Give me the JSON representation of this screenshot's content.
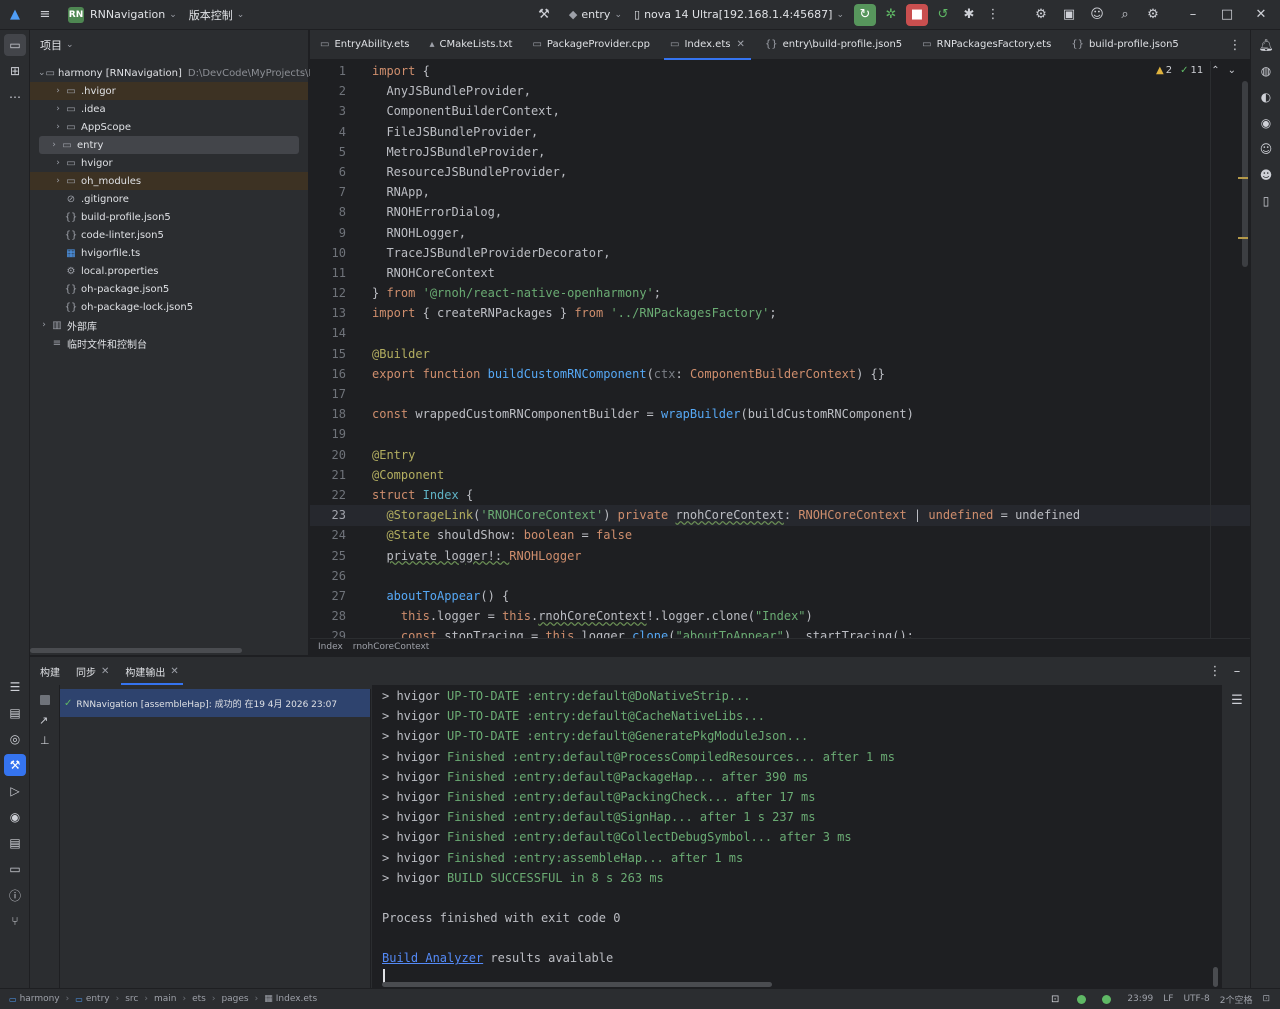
{
  "titlebar": {
    "project_badge": "RN",
    "project_name": "RNNavigation",
    "vcs": "版本控制",
    "module": "entry",
    "device": "nova 14 Ultra[192.168.1.4:45687]"
  },
  "project_panel": {
    "title": "项目",
    "tree": [
      {
        "label": "harmony [RNNavigation]",
        "hint": "D:\\DevCode\\MyProjects\\RNNa",
        "indent": 0,
        "chev": "v",
        "icon": "module-icon",
        "style": ""
      },
      {
        "label": ".hvigor",
        "indent": 1,
        "chev": ">",
        "icon": "folder-icon",
        "style": "excl"
      },
      {
        "label": ".idea",
        "indent": 1,
        "chev": ">",
        "icon": "folder-icon",
        "style": ""
      },
      {
        "label": "AppScope",
        "indent": 1,
        "chev": ">",
        "icon": "folder-icon",
        "style": ""
      },
      {
        "label": "entry",
        "indent": 1,
        "chev": ">",
        "icon": "module-icon",
        "style": "sel"
      },
      {
        "label": "hvigor",
        "indent": 1,
        "chev": ">",
        "icon": "folder-icon",
        "style": ""
      },
      {
        "label": "oh_modules",
        "indent": 1,
        "chev": ">",
        "icon": "folder-icon",
        "style": "excl"
      },
      {
        "label": ".gitignore",
        "indent": 1,
        "chev": "",
        "icon": "ignore-icon",
        "style": ""
      },
      {
        "label": "build-profile.json5",
        "indent": 1,
        "chev": "",
        "icon": "json-icon",
        "style": ""
      },
      {
        "label": "code-linter.json5",
        "indent": 1,
        "chev": "",
        "icon": "json-icon",
        "style": ""
      },
      {
        "label": "hvigorfile.ts",
        "indent": 1,
        "chev": "",
        "icon": "ts-icon",
        "style": ""
      },
      {
        "label": "local.properties",
        "indent": 1,
        "chev": "",
        "icon": "settings-icon",
        "style": ""
      },
      {
        "label": "oh-package.json5",
        "indent": 1,
        "chev": "",
        "icon": "json-icon",
        "style": ""
      },
      {
        "label": "oh-package-lock.json5",
        "indent": 1,
        "chev": "",
        "icon": "json-icon",
        "style": ""
      },
      {
        "label": "外部库",
        "indent": 0,
        "chev": ">",
        "icon": "library-icon",
        "style": ""
      },
      {
        "label": "临时文件和控制台",
        "indent": 0,
        "chev": "",
        "icon": "scratch-icon",
        "style": ""
      }
    ]
  },
  "editor_tabs": [
    {
      "label": "EntryAbility.ets",
      "icon": "▭",
      "active": false,
      "closable": false
    },
    {
      "label": "CMakeLists.txt",
      "icon": "▴",
      "active": false,
      "closable": false
    },
    {
      "label": "PackageProvider.cpp",
      "icon": "▭",
      "active": false,
      "closable": false
    },
    {
      "label": "Index.ets",
      "icon": "▭",
      "active": true,
      "closable": true
    },
    {
      "label": "entry\\build-profile.json5",
      "icon": "{}",
      "active": false,
      "closable": false
    },
    {
      "label": "RNPackagesFactory.ets",
      "icon": "▭",
      "active": false,
      "closable": false
    },
    {
      "label": "build-profile.json5",
      "icon": "{}",
      "active": false,
      "closable": false
    }
  ],
  "inspections": {
    "warnings": "2",
    "ok": "11"
  },
  "editor": {
    "current_line": 23,
    "lines": [
      [
        [
          "k",
          "import"
        ],
        [
          "p",
          " {"
        ]
      ],
      [
        [
          "p",
          "  AnyJSBundleProvider,"
        ]
      ],
      [
        [
          "p",
          "  ComponentBuilderContext,"
        ]
      ],
      [
        [
          "p",
          "  FileJSBundleProvider,"
        ]
      ],
      [
        [
          "p",
          "  MetroJSBundleProvider,"
        ]
      ],
      [
        [
          "p",
          "  ResourceJSBundleProvider,"
        ]
      ],
      [
        [
          "p",
          "  RNApp,"
        ]
      ],
      [
        [
          "p",
          "  RNOHErrorDialog,"
        ]
      ],
      [
        [
          "p",
          "  RNOHLogger,"
        ]
      ],
      [
        [
          "p",
          "  TraceJSBundleProviderDecorator,"
        ]
      ],
      [
        [
          "p",
          "  RNOHCoreContext"
        ]
      ],
      [
        [
          "p",
          "} "
        ],
        [
          "k",
          "from"
        ],
        [
          "p",
          " "
        ],
        [
          "s",
          "'@rnoh/react-native-openharmony'"
        ],
        [
          "p",
          ";"
        ]
      ],
      [
        [
          "k",
          "import"
        ],
        [
          "p",
          " { createRNPackages } "
        ],
        [
          "k",
          "from"
        ],
        [
          "p",
          " "
        ],
        [
          "s",
          "'../RNPackagesFactory'"
        ],
        [
          "p",
          ";"
        ]
      ],
      [],
      [
        [
          "a",
          "@Builder"
        ]
      ],
      [
        [
          "k",
          "export function"
        ],
        [
          "p",
          " "
        ],
        [
          "f",
          "buildCustomRNComponent"
        ],
        [
          "p",
          "("
        ],
        [
          "gray",
          "ctx"
        ],
        [
          "p",
          ": "
        ],
        [
          "k",
          "ComponentBuilderContext"
        ],
        [
          "p",
          ") {}"
        ]
      ],
      [],
      [
        [
          "k",
          "const"
        ],
        [
          "p",
          " wrappedCustomRNComponentBuilder = "
        ],
        [
          "f",
          "wrapBuilder"
        ],
        [
          "p",
          "(buildCustomRNComponent)"
        ]
      ],
      [],
      [
        [
          "a",
          "@Entry"
        ]
      ],
      [
        [
          "a",
          "@Component"
        ]
      ],
      [
        [
          "k",
          "struct"
        ],
        [
          "p",
          " "
        ],
        [
          "cls",
          "Index"
        ],
        [
          "p",
          " {"
        ]
      ],
      [
        [
          "p",
          "  "
        ],
        [
          "a",
          "@StorageLink"
        ],
        [
          "p",
          "("
        ],
        [
          "s",
          "'RNOHCoreContext'"
        ],
        [
          "p",
          ") "
        ],
        [
          "k",
          "private"
        ],
        [
          "p",
          " "
        ],
        [
          "und",
          "rnohCoreContext"
        ],
        [
          "p",
          ": "
        ],
        [
          "k",
          "RNOHCoreContext"
        ],
        [
          "p",
          " | "
        ],
        [
          "k",
          "undefined"
        ],
        [
          "p",
          " = undefined"
        ]
      ],
      [
        [
          "p",
          "  "
        ],
        [
          "a",
          "@State"
        ],
        [
          "p",
          " shouldShow: "
        ],
        [
          "k",
          "boolean"
        ],
        [
          "p",
          " = "
        ],
        [
          "k",
          "false"
        ]
      ],
      [
        [
          "p",
          "  "
        ],
        [
          "und",
          "private logger!: "
        ],
        [
          "k",
          "RNOHLogger"
        ]
      ],
      [],
      [
        [
          "p",
          "  "
        ],
        [
          "f",
          "aboutToAppear"
        ],
        [
          "p",
          "() {"
        ]
      ],
      [
        [
          "p",
          "    "
        ],
        [
          "k",
          "this"
        ],
        [
          "p",
          ".logger = "
        ],
        [
          "k",
          "this"
        ],
        [
          "p",
          "."
        ],
        [
          "und",
          "rnohCoreContext"
        ],
        [
          "p",
          "!.logger.clone("
        ],
        [
          "s",
          "\"Index\""
        ],
        [
          "p",
          ")"
        ]
      ],
      [
        [
          "p",
          "    "
        ],
        [
          "k",
          "const"
        ],
        [
          "p",
          " stopTracing = "
        ],
        [
          "k",
          "this"
        ],
        [
          "p",
          ".logger."
        ],
        [
          "f",
          "clone"
        ],
        [
          "p",
          "("
        ],
        [
          "s",
          "\"aboutToAppear\""
        ],
        [
          "p",
          "). startTracing();"
        ]
      ]
    ]
  },
  "editor_breadcrumb": [
    "Index",
    "rnohCoreContext"
  ],
  "bottom_panel": {
    "tabs": [
      {
        "label": "构建",
        "active": false,
        "closable": false
      },
      {
        "label": "同步",
        "active": false,
        "closable": true
      },
      {
        "label": "构建输出",
        "active": true,
        "closable": true
      }
    ],
    "build_entry": "RNNavigation [assembleHap]: 成功的 在19 4月 2026 23:07",
    "console": [
      [
        [
          "p",
          "> hvigor "
        ],
        [
          "g",
          "UP-TO-DATE :entry:default@DoNativeStrip..."
        ]
      ],
      [
        [
          "p",
          "> hvigor "
        ],
        [
          "g",
          "UP-TO-DATE :entry:default@CacheNativeLibs..."
        ]
      ],
      [
        [
          "p",
          "> hvigor "
        ],
        [
          "g",
          "UP-TO-DATE :entry:default@GeneratePkgModuleJson..."
        ]
      ],
      [
        [
          "p",
          "> hvigor "
        ],
        [
          "g",
          "Finished :entry:default@ProcessCompiledResources... after 1 ms"
        ]
      ],
      [
        [
          "p",
          "> hvigor "
        ],
        [
          "g",
          "Finished :entry:default@PackageHap... after 390 ms"
        ]
      ],
      [
        [
          "p",
          "> hvigor "
        ],
        [
          "g",
          "Finished :entry:default@PackingCheck... after 17 ms"
        ]
      ],
      [
        [
          "p",
          "> hvigor "
        ],
        [
          "g",
          "Finished :entry:default@SignHap... after 1 s 237 ms"
        ]
      ],
      [
        [
          "p",
          "> hvigor "
        ],
        [
          "g",
          "Finished :entry:default@CollectDebugSymbol... after 3 ms"
        ]
      ],
      [
        [
          "p",
          "> hvigor "
        ],
        [
          "g",
          "Finished :entry:assembleHap... after 1 ms"
        ]
      ],
      [
        [
          "p",
          "> hvigor "
        ],
        [
          "g",
          "BUILD SUCCESSFUL in 8 s 263 ms"
        ]
      ],
      [],
      [
        [
          "p",
          "Process finished with exit code 0"
        ]
      ],
      [],
      [
        [
          "l",
          "Build Analyzer"
        ],
        [
          "p",
          " results available"
        ]
      ]
    ]
  },
  "statusbar": {
    "crumbs": [
      "harmony",
      "entry",
      "src",
      "main",
      "ets",
      "pages",
      "Index.ets"
    ],
    "position": "23:99",
    "line_sep": "LF",
    "encoding": "UTF-8",
    "indent": "2个空格"
  }
}
